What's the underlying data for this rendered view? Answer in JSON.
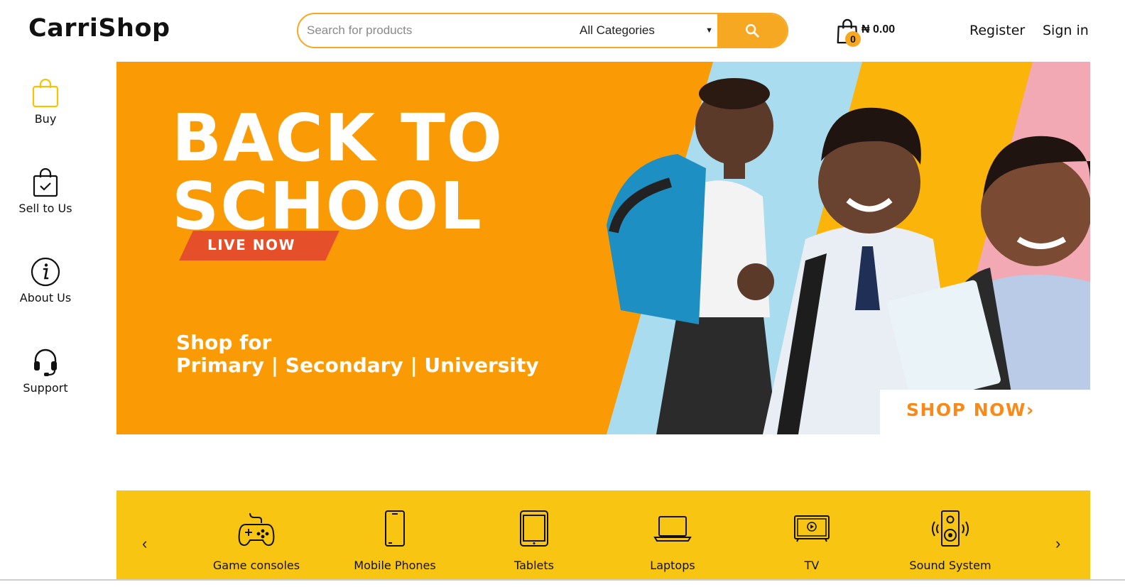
{
  "header": {
    "logo": "CarriShop",
    "search": {
      "placeholder": "Search for products",
      "category": "All Categories"
    },
    "cart": {
      "count": "0",
      "total": "₦ 0.00"
    },
    "register": "Register",
    "sign_in": "Sign in"
  },
  "sidebar": {
    "items": [
      {
        "label": "Buy",
        "icon": "shopping-bag-icon"
      },
      {
        "label": "Sell to Us",
        "icon": "bag-check-icon"
      },
      {
        "label": "About Us",
        "icon": "info-icon"
      },
      {
        "label": "Support",
        "icon": "headset-icon"
      }
    ]
  },
  "banner": {
    "title": "BACK TO\nSCHOOL",
    "tag": "LIVE NOW",
    "line1": "Shop for",
    "line2": "Primary | Secondary | University",
    "cta": "SHOP NOW›",
    "colors": {
      "background": "#fa9a05",
      "stripe_blue": "#a9dcef",
      "stripe_yellow": "#fbb40a",
      "stripe_pink": "#f2a9b3"
    }
  },
  "categories": {
    "items": [
      {
        "label": "Game consoles",
        "icon": "gamepad-icon"
      },
      {
        "label": "Mobile Phones",
        "icon": "mobile-phone-icon"
      },
      {
        "label": "Tablets",
        "icon": "tablet-icon"
      },
      {
        "label": "Laptops",
        "icon": "laptop-icon"
      },
      {
        "label": "TV",
        "icon": "tv-icon"
      },
      {
        "label": "Sound System",
        "icon": "speaker-icon"
      }
    ],
    "prev": "‹",
    "next": "›"
  },
  "colors": {
    "accent": "#f7a823",
    "category_bar": "#f8c513"
  }
}
